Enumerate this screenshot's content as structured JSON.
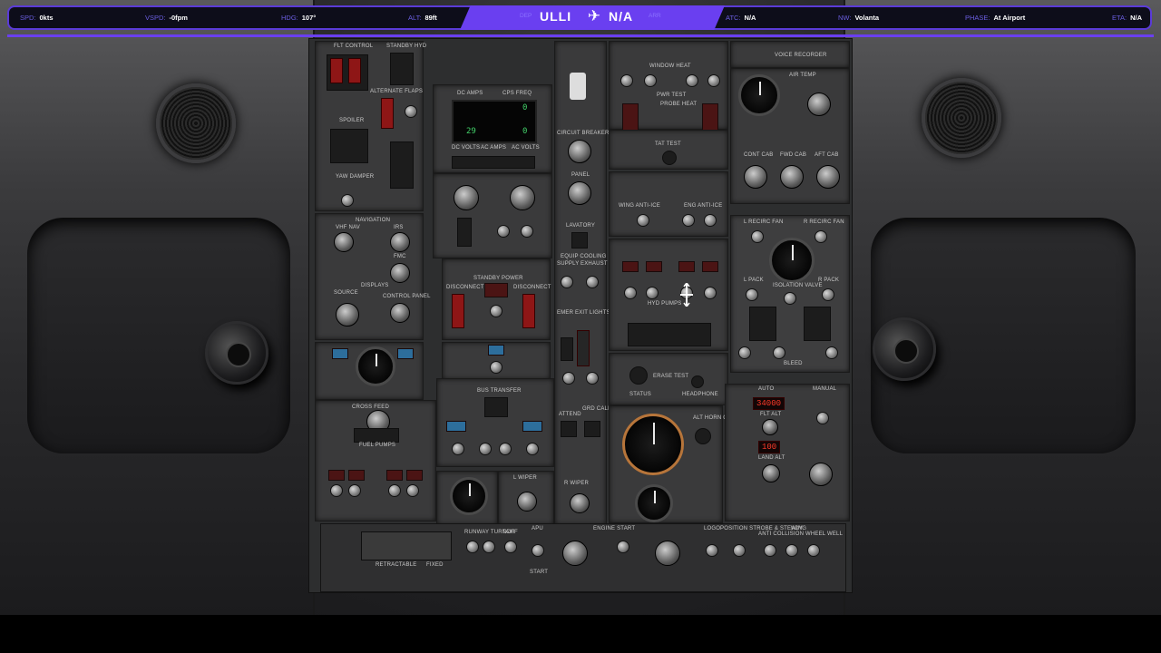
{
  "hud": {
    "spd_label": "SPD:",
    "spd_value": "0kts",
    "vspd_label": "VSPD:",
    "vspd_value": "-0fpm",
    "hdg_label": "HDG:",
    "hdg_value": "107°",
    "alt_label": "ALT:",
    "alt_value": "89ft",
    "dep_hint": "DEP",
    "origin": "ULLI",
    "destination": "N/A",
    "arr_hint": "ARR",
    "atc_label": "ATC:",
    "atc_value": "N/A",
    "nw_label": "NW:",
    "nw_value": "Volanta",
    "phase_label": "PHASE:",
    "phase_value": "At Airport",
    "eta_label": "ETA:",
    "eta_value": "N/A",
    "accent_color": "#6a3ff0"
  },
  "panel": {
    "flt_control": "FLT CONTROL",
    "standby_hyd": "STANDBY HYD",
    "alternate_flaps": "ALTERNATE FLAPS",
    "spoiler": "SPOILER",
    "yaw_damper": "YAW DAMPER",
    "dc_amps": "DC AMPS",
    "cps_freq": "CPS FREQ",
    "dc_volts": "DC VOLTS",
    "ac_amps": "AC AMPS",
    "ac_volts": "AC VOLTS",
    "readout_left": "29",
    "readout_right": "0",
    "readout_top_right": "0",
    "circuit_breaker": "CIRCUIT BREAKER",
    "panel_label": "PANEL",
    "window_heat": "WINDOW HEAT",
    "pwr_test": "PWR TEST",
    "probe_heat": "PROBE HEAT",
    "tat_test": "TAT TEST",
    "voice_recorder": "VOICE RECORDER",
    "air_temp": "AIR TEMP",
    "cont_cab": "CONT CAB",
    "fwd_cab": "FWD CAB",
    "aft_cab": "AFT CAB",
    "navigation": "NAVIGATION",
    "vhf_nav": "VHF NAV",
    "irs": "IRS",
    "fmc": "FMC",
    "displays": "DISPLAYS",
    "source": "SOURCE",
    "control_panel": "CONTROL PANEL",
    "standby_power": "STANDBY POWER",
    "disconnect": "DISCONNECT",
    "lavatory": "LAVATORY",
    "equip_cooling": "EQUIP COOLING",
    "supply": "SUPPLY",
    "exhaust": "EXHAUST",
    "emer_exit_lights": "EMER EXIT LIGHTS",
    "wing_anti_ice": "WING ANTI-ICE",
    "eng_anti_ice": "ENG ANTI-ICE",
    "hyd_pumps": "HYD PUMPS",
    "l_recirc_fan": "L RECIRC FAN",
    "r_recirc_fan": "R RECIRC FAN",
    "l_pack": "L PACK",
    "r_pack": "R PACK",
    "isolation_valve": "ISOLATION VALVE",
    "bleed": "BLEED",
    "cross_feed": "CROSS FEED",
    "fuel_pumps": "FUEL PUMPS",
    "bus_transfer": "BUS TRANSFER",
    "attend": "ATTEND",
    "grd_call": "GRD CALL",
    "auto": "AUTO",
    "manual": "MANUAL",
    "flt_alt": "FLT ALT",
    "flt_alt_value": "34000",
    "land_alt": "LAND ALT",
    "land_alt_value": "100",
    "alt_horn_cutout": "ALT HORN CUTOUT",
    "l_wiper": "L WIPER",
    "r_wiper": "R WIPER",
    "runway_turnoff": "RUNWAY TURNOFF",
    "taxi": "TAXI",
    "apu": "APU",
    "engine_start": "ENGINE START",
    "logo": "LOGO",
    "position_strobe": "POSITION STROBE & STEADY",
    "anti_collision": "ANTI COLLISION",
    "wing": "WING",
    "wheel_well": "WHEEL WELL",
    "retractable": "RETRACTABLE",
    "fixed": "FIXED",
    "start": "START",
    "status": "STATUS",
    "headphone": "HEADPHONE",
    "erase_test": "ERASE TEST"
  }
}
